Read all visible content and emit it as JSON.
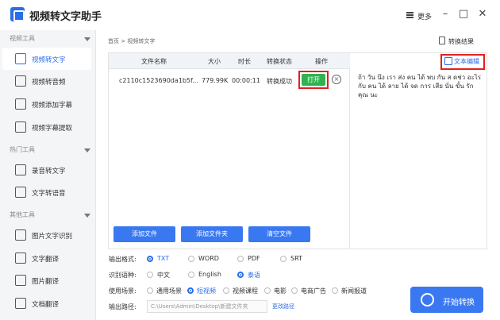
{
  "app": {
    "title": "视频转文字助手",
    "more": "更多"
  },
  "window": {
    "minimize": "–",
    "maximize": "□",
    "close": "✕"
  },
  "sidebar": {
    "sections": [
      {
        "label": "视频工具",
        "items": [
          "视频转文字",
          "视频转音频",
          "视频添加字幕",
          "视频字幕提取"
        ]
      },
      {
        "label": "热门工具",
        "items": [
          "录音转文字",
          "文字转语音"
        ]
      },
      {
        "label": "其他工具",
        "items": [
          "图片文字识别",
          "文字翻译",
          "图片翻译",
          "文档翻译"
        ]
      }
    ],
    "active": "视频转文字"
  },
  "main": {
    "breadcrumb": "首页 > 视频转文字",
    "convert_result": "转换结果",
    "table": {
      "headers": [
        "文件名称",
        "大小",
        "时长",
        "转换状态",
        "操作"
      ],
      "rows": [
        {
          "name": "c2110c1523690da1b5f...",
          "size": "779.99K",
          "duration": "00:00:11",
          "status": "转换成功",
          "action": "打开"
        }
      ]
    },
    "buttons": {
      "add_file": "添加文件",
      "add_folder": "添加文件夹",
      "clear": "清空文件"
    },
    "text_edit": "文本编辑",
    "result_text": "ถ้า วัน นึง เรา ส่ง คน ได้ พบ กัน ส ดช่ว อะไร กับ คน ได้ ลาย ได้ จด การ เสีย นั่น ขั้น รัก คุณ นะ"
  },
  "options": {
    "format_label": "输出格式:",
    "formats": [
      "TXT",
      "WORD",
      "PDF",
      "SRT"
    ],
    "format_selected": "TXT",
    "language_label": "识别语种:",
    "languages": [
      "中文",
      "English",
      "泰语"
    ],
    "language_selected": "泰语",
    "scene_label": "使用场景:",
    "scenes": [
      "通用场景",
      "短视频",
      "视频课程",
      "电影",
      "电商广告",
      "新闻报道"
    ],
    "scene_selected": "短视频",
    "path_label": "输出路径:",
    "path_value": "C:\\Users\\Admin\\Desktop\\新建文件夹",
    "change_path": "更改路径",
    "start": "开始转换"
  }
}
